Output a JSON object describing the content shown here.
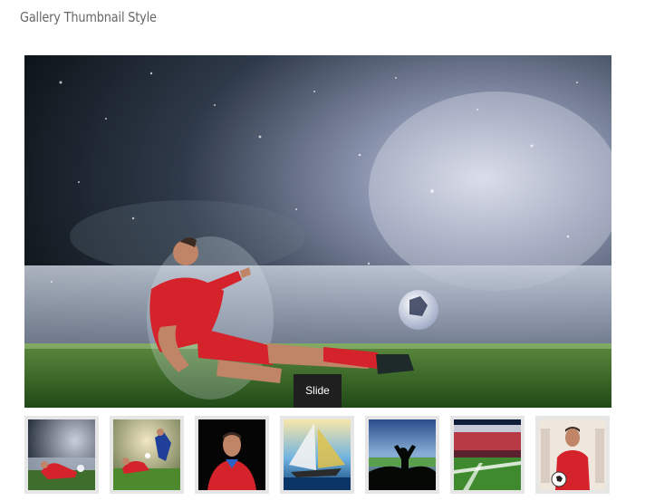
{
  "page": {
    "title": "Gallery Thumbnail Style"
  },
  "slider": {
    "caption": "Slide",
    "active_index": 0
  },
  "thumbnails": [
    {
      "name": "thumb-soccer-slide-tackle"
    },
    {
      "name": "thumb-soccer-players"
    },
    {
      "name": "thumb-man-red-shirt"
    },
    {
      "name": "thumb-sailboat"
    },
    {
      "name": "thumb-stadium-fan"
    },
    {
      "name": "thumb-stadium-field"
    },
    {
      "name": "thumb-player-with-ball"
    }
  ]
}
